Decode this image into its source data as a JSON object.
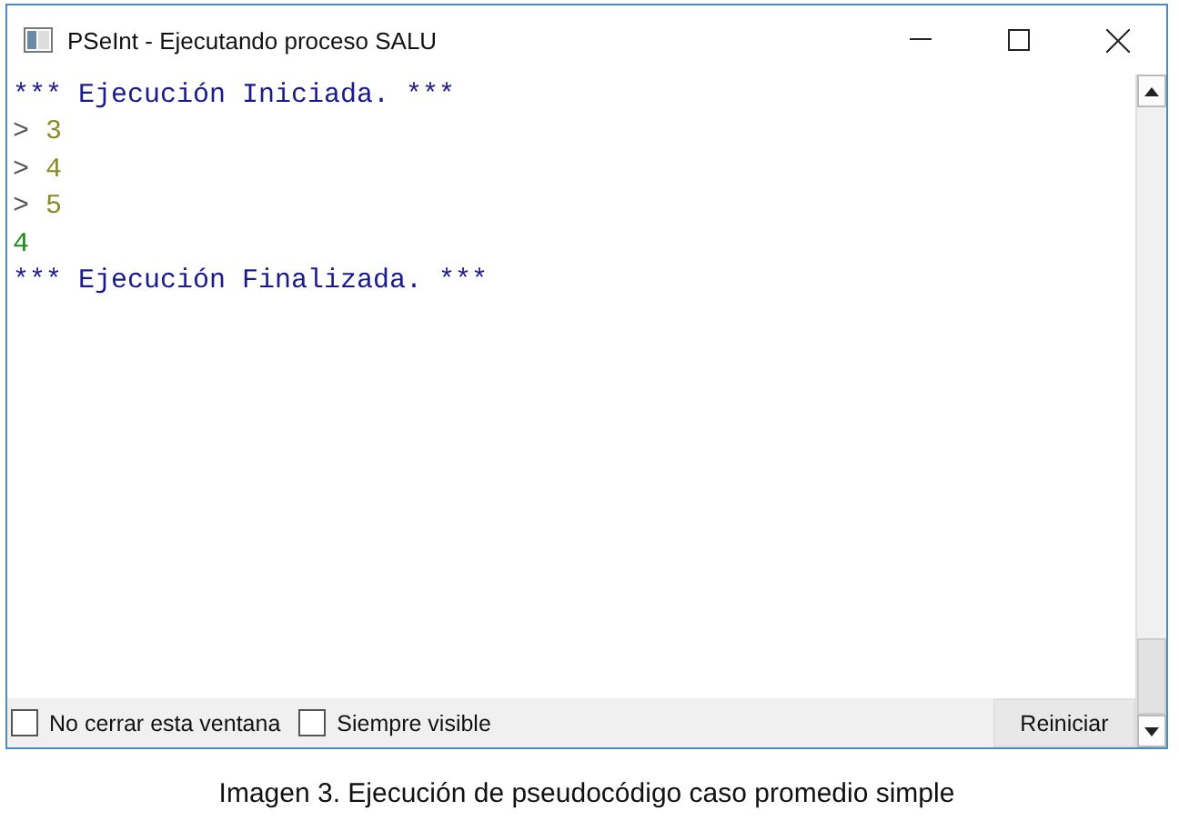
{
  "window": {
    "title": "PSeInt - Ejecutando proceso SALU"
  },
  "console": {
    "lines": [
      {
        "kind": "banner",
        "text": "*** Ejecución Iniciada. ***"
      },
      {
        "kind": "input",
        "prompt": ">",
        "value": "3"
      },
      {
        "kind": "input",
        "prompt": ">",
        "value": "4"
      },
      {
        "kind": "input",
        "prompt": ">",
        "value": "5"
      },
      {
        "kind": "output",
        "text": "4"
      },
      {
        "kind": "banner",
        "text": "*** Ejecución Finalizada. ***"
      }
    ]
  },
  "bottom_bar": {
    "checkboxes": [
      {
        "label": "No cerrar esta ventana",
        "checked": false
      },
      {
        "label": "Siempre visible",
        "checked": false
      }
    ],
    "button": "Reiniciar"
  },
  "caption": "Imagen 3. Ejecución de pseudocódigo caso promedio simple"
}
